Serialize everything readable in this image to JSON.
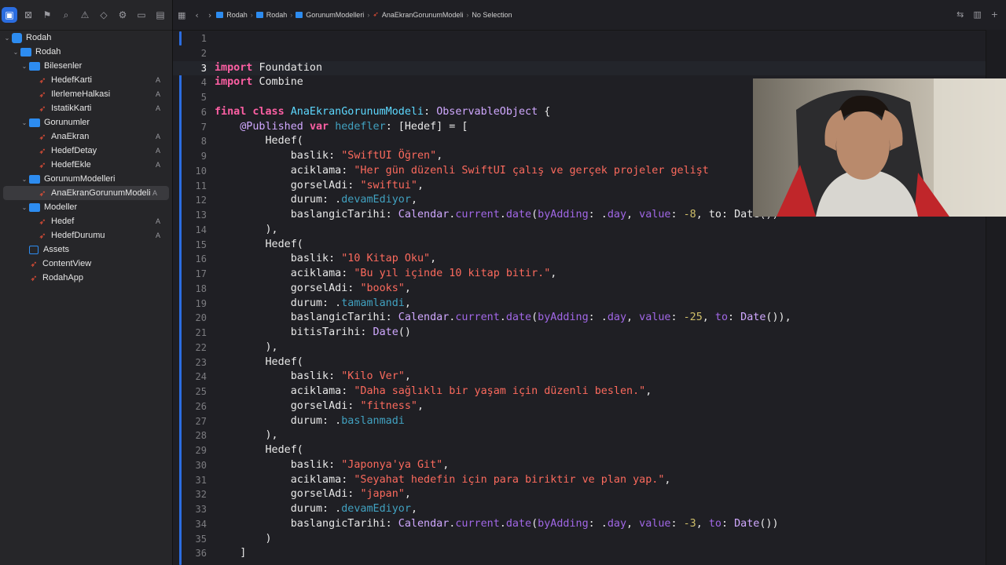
{
  "navigator": {
    "icons": [
      "folder-icon",
      "source-control-icon",
      "bookmark-icon",
      "find-icon",
      "issue-icon",
      "test-icon",
      "debug-icon",
      "breakpoint-icon",
      "report-icon"
    ],
    "tree": [
      {
        "label": "Rodah",
        "kind": "project",
        "depth": 0,
        "expanded": true
      },
      {
        "label": "Rodah",
        "kind": "folder",
        "depth": 1,
        "expanded": true
      },
      {
        "label": "Bilesenler",
        "kind": "folder",
        "depth": 2,
        "expanded": true
      },
      {
        "label": "HedefKarti",
        "kind": "swift",
        "depth": 3,
        "badge": "A"
      },
      {
        "label": "IlerlemeHalkasi",
        "kind": "swift",
        "depth": 3,
        "badge": "A"
      },
      {
        "label": "IstatikKarti",
        "kind": "swift",
        "depth": 3,
        "badge": "A"
      },
      {
        "label": "Gorunumler",
        "kind": "folder",
        "depth": 2,
        "expanded": true
      },
      {
        "label": "AnaEkran",
        "kind": "swift",
        "depth": 3,
        "badge": "A"
      },
      {
        "label": "HedefDetay",
        "kind": "swift",
        "depth": 3,
        "badge": "A"
      },
      {
        "label": "HedefEkle",
        "kind": "swift",
        "depth": 3,
        "badge": "A"
      },
      {
        "label": "GorunumModelleri",
        "kind": "folder",
        "depth": 2,
        "expanded": true
      },
      {
        "label": "AnaEkranGorunumModeli",
        "kind": "swift",
        "depth": 3,
        "badge": "A",
        "selected": true
      },
      {
        "label": "Modeller",
        "kind": "folder",
        "depth": 2,
        "expanded": true
      },
      {
        "label": "Hedef",
        "kind": "swift",
        "depth": 3,
        "badge": "A"
      },
      {
        "label": "HedefDurumu",
        "kind": "swift",
        "depth": 3,
        "badge": "A"
      },
      {
        "label": "Assets",
        "kind": "assets",
        "depth": 2
      },
      {
        "label": "ContentView",
        "kind": "swift",
        "depth": 2
      },
      {
        "label": "RodahApp",
        "kind": "swift",
        "depth": 2
      }
    ]
  },
  "jumpbar": {
    "crumbs": [
      {
        "label": "Rodah",
        "kind": "project"
      },
      {
        "label": "Rodah",
        "kind": "folder"
      },
      {
        "label": "GorunumModelleri",
        "kind": "folder"
      },
      {
        "label": "AnaEkranGorunumModeli",
        "kind": "swift"
      },
      {
        "label": "No Selection",
        "kind": "none"
      }
    ]
  },
  "editor": {
    "current_line": 3,
    "lines": [
      {
        "n": "1",
        "t": []
      },
      {
        "n": "2",
        "t": []
      },
      {
        "n": "3",
        "t": [
          [
            "kw",
            "import"
          ],
          [
            "",
            "Foundation"
          ]
        ]
      },
      {
        "n": "4",
        "t": [
          [
            "kw",
            "import"
          ],
          [
            "",
            "Combine"
          ]
        ]
      },
      {
        "n": "5",
        "t": []
      },
      {
        "n": "6",
        "t": [
          [
            "kw",
            "final class"
          ],
          [
            "cls",
            "AnaEkranGorunumModeli"
          ],
          [
            "",
            ": "
          ],
          [
            "ty",
            "ObservableObject"
          ],
          [
            "",
            " {"
          ]
        ]
      },
      {
        "n": "7",
        "t": [
          [
            "",
            "    "
          ],
          [
            "attr",
            "@Published"
          ],
          [
            "",
            ""
          ],
          [
            "kw",
            "var"
          ],
          [
            "varn",
            "hedefler"
          ],
          [
            "",
            ": [Hedef] = ["
          ]
        ]
      },
      {
        "n": "8",
        "t": [
          [
            "",
            "        Hedef("
          ]
        ]
      },
      {
        "n": "9",
        "t": [
          [
            "",
            "            baslik: "
          ],
          [
            "str",
            "\"SwiftUI Öğren\""
          ],
          [
            "",
            ","
          ]
        ]
      },
      {
        "n": "10",
        "t": [
          [
            "",
            "            aciklama: "
          ],
          [
            "str",
            "\"Her gün düzenli SwiftUI çalış ve gerçek projeler gelişt"
          ]
        ]
      },
      {
        "n": "11",
        "t": [
          [
            "",
            "            gorselAdi: "
          ],
          [
            "str",
            "\"swiftui\""
          ],
          [
            "",
            ","
          ]
        ]
      },
      {
        "n": "12",
        "t": [
          [
            "",
            "            durum: ."
          ],
          [
            "enumc",
            "devamEdiyor"
          ],
          [
            "",
            ","
          ]
        ]
      },
      {
        "n": "13",
        "t": [
          [
            "",
            "            baslangicTarihi: "
          ],
          [
            "ty",
            "Calendar"
          ],
          [
            "",
            "."
          ],
          [
            "fn",
            "current"
          ],
          [
            "",
            "."
          ],
          [
            "fn",
            "date"
          ],
          [
            "",
            "("
          ],
          [
            "fn",
            "byAdding"
          ],
          [
            "",
            ": ."
          ],
          [
            "fn",
            "day"
          ],
          [
            "",
            ", "
          ],
          [
            "fn",
            "value"
          ],
          [
            "",
            ": "
          ],
          [
            "num",
            "-8"
          ],
          [
            "",
            ", to: Date())"
          ]
        ]
      },
      {
        "n": "14",
        "t": [
          [
            "",
            "        ),"
          ]
        ]
      },
      {
        "n": "15",
        "t": [
          [
            "",
            "        Hedef("
          ]
        ]
      },
      {
        "n": "16",
        "t": [
          [
            "",
            "            baslik: "
          ],
          [
            "str",
            "\"10 Kitap Oku\""
          ],
          [
            "",
            ","
          ]
        ]
      },
      {
        "n": "17",
        "t": [
          [
            "",
            "            aciklama: "
          ],
          [
            "str",
            "\"Bu yıl içinde 10 kitap bitir.\""
          ],
          [
            "",
            ","
          ]
        ]
      },
      {
        "n": "18",
        "t": [
          [
            "",
            "            gorselAdi: "
          ],
          [
            "str",
            "\"books\""
          ],
          [
            "",
            ","
          ]
        ]
      },
      {
        "n": "19",
        "t": [
          [
            "",
            "            durum: ."
          ],
          [
            "enumc",
            "tamamlandi"
          ],
          [
            "",
            ","
          ]
        ]
      },
      {
        "n": "20",
        "t": [
          [
            "",
            "            baslangicTarihi: "
          ],
          [
            "ty",
            "Calendar"
          ],
          [
            "",
            "."
          ],
          [
            "fn",
            "current"
          ],
          [
            "",
            "."
          ],
          [
            "fn",
            "date"
          ],
          [
            "",
            "("
          ],
          [
            "fn",
            "byAdding"
          ],
          [
            "",
            ": ."
          ],
          [
            "fn",
            "day"
          ],
          [
            "",
            ", "
          ],
          [
            "fn",
            "value"
          ],
          [
            "",
            ": "
          ],
          [
            "num",
            "-25"
          ],
          [
            "",
            ", "
          ],
          [
            "fn",
            "to"
          ],
          [
            "",
            ": "
          ],
          [
            "ty",
            "Date"
          ],
          [
            "",
            "()),"
          ]
        ]
      },
      {
        "n": "21",
        "t": [
          [
            "",
            "            bitisTarihi: "
          ],
          [
            "ty",
            "Date"
          ],
          [
            "",
            "()"
          ]
        ]
      },
      {
        "n": "22",
        "t": [
          [
            "",
            "        ),"
          ]
        ]
      },
      {
        "n": "23",
        "t": [
          [
            "",
            "        Hedef("
          ]
        ]
      },
      {
        "n": "24",
        "t": [
          [
            "",
            "            baslik: "
          ],
          [
            "str",
            "\"Kilo Ver\""
          ],
          [
            "",
            ","
          ]
        ]
      },
      {
        "n": "25",
        "t": [
          [
            "",
            "            aciklama: "
          ],
          [
            "str",
            "\"Daha sağlıklı bir yaşam için düzenli beslen.\""
          ],
          [
            "",
            ","
          ]
        ]
      },
      {
        "n": "26",
        "t": [
          [
            "",
            "            gorselAdi: "
          ],
          [
            "str",
            "\"fitness\""
          ],
          [
            "",
            ","
          ]
        ]
      },
      {
        "n": "27",
        "t": [
          [
            "",
            "            durum: ."
          ],
          [
            "enumc",
            "baslanmadi"
          ]
        ]
      },
      {
        "n": "28",
        "t": [
          [
            "",
            "        ),"
          ]
        ]
      },
      {
        "n": "29",
        "t": [
          [
            "",
            "        Hedef("
          ]
        ]
      },
      {
        "n": "30",
        "t": [
          [
            "",
            "            baslik: "
          ],
          [
            "str",
            "\"Japonya'ya Git\""
          ],
          [
            "",
            ","
          ]
        ]
      },
      {
        "n": "31",
        "t": [
          [
            "",
            "            aciklama: "
          ],
          [
            "str",
            "\"Seyahat hedefin için para biriktir ve plan yap.\""
          ],
          [
            "",
            ","
          ]
        ]
      },
      {
        "n": "32",
        "t": [
          [
            "",
            "            gorselAdi: "
          ],
          [
            "str",
            "\"japan\""
          ],
          [
            "",
            ","
          ]
        ]
      },
      {
        "n": "33",
        "t": [
          [
            "",
            "            durum: ."
          ],
          [
            "enumc",
            "devamEdiyor"
          ],
          [
            "",
            ","
          ]
        ]
      },
      {
        "n": "34",
        "t": [
          [
            "",
            "            baslangicTarihi: "
          ],
          [
            "ty",
            "Calendar"
          ],
          [
            "",
            "."
          ],
          [
            "fn",
            "current"
          ],
          [
            "",
            "."
          ],
          [
            "fn",
            "date"
          ],
          [
            "",
            "("
          ],
          [
            "fn",
            "byAdding"
          ],
          [
            "",
            ": ."
          ],
          [
            "fn",
            "day"
          ],
          [
            "",
            ", "
          ],
          [
            "fn",
            "value"
          ],
          [
            "",
            ": "
          ],
          [
            "num",
            "-3"
          ],
          [
            "",
            ", "
          ],
          [
            "fn",
            "to"
          ],
          [
            "",
            ": "
          ],
          [
            "ty",
            "Date"
          ],
          [
            "",
            "())"
          ]
        ]
      },
      {
        "n": "35",
        "t": [
          [
            "",
            "        )"
          ]
        ]
      },
      {
        "n": "36",
        "t": [
          [
            "",
            "    ]"
          ]
        ]
      }
    ]
  }
}
